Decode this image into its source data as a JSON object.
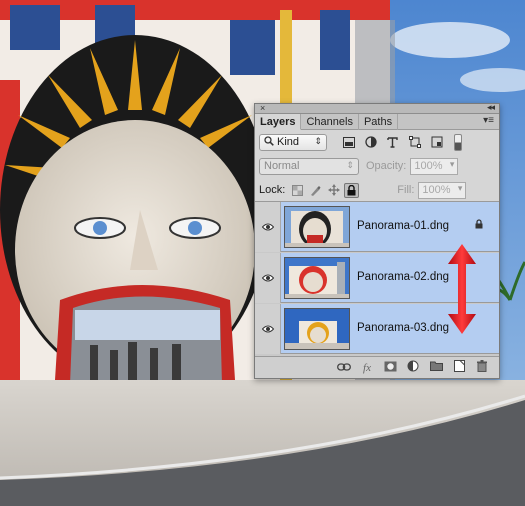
{
  "panel": {
    "close_glyph": "×",
    "collapse_glyph": "◂◂",
    "tabs": [
      {
        "label": "Layers",
        "active": true
      },
      {
        "label": "Channels",
        "active": false
      },
      {
        "label": "Paths",
        "active": false
      }
    ],
    "menu_glyph": "▾≡",
    "filter": {
      "label": "Kind",
      "icon": "search-icon",
      "arrow": "⇕"
    },
    "blend": {
      "mode": "Normal",
      "arrow": "⇕"
    },
    "opacity": {
      "label": "Opacity:",
      "value": "100%",
      "arrow": "▾"
    },
    "lock": {
      "label": "Lock:"
    },
    "fill": {
      "label": "Fill:",
      "value": "100%",
      "arrow": "▾"
    },
    "layers": [
      {
        "name": "Panorama-01.dng",
        "selected": true,
        "locked": true,
        "lock_glyph": "🔒"
      },
      {
        "name": "Panorama-02.dng",
        "selected": true,
        "locked": false
      },
      {
        "name": "Panorama-03.dng",
        "selected": true,
        "locked": false
      }
    ],
    "footer_icons": [
      "link-icon",
      "fx-icon",
      "mask-icon",
      "adjustment-icon",
      "folder-icon",
      "new-layer-icon",
      "trash-icon"
    ],
    "footer_labels": {
      "fx": "fx"
    }
  },
  "colors": {
    "selected_row": "#b4cdf1",
    "annotation_arrow": "#e0141e",
    "panel_bg": "#d6d6d6"
  }
}
